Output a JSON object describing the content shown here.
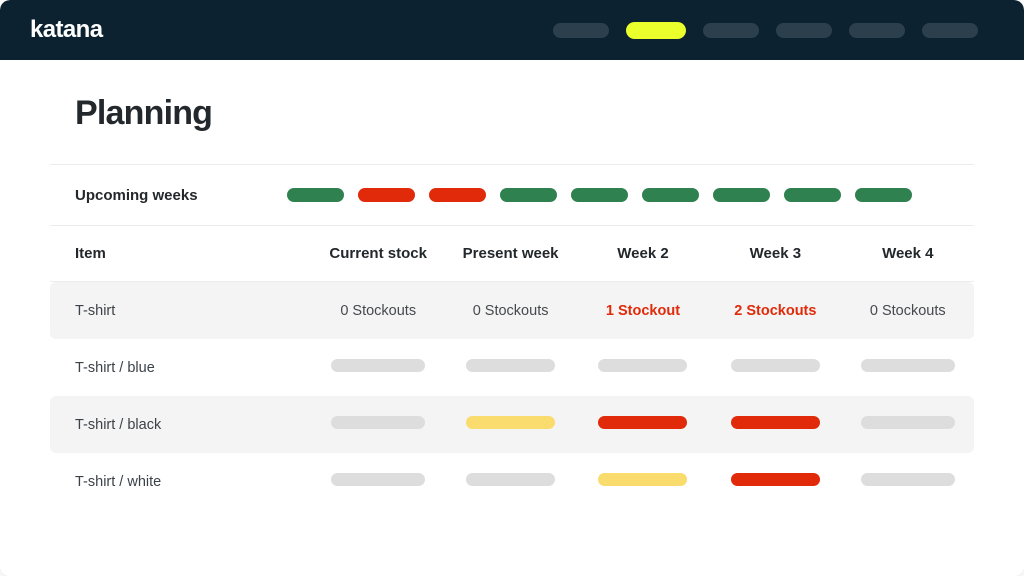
{
  "app": {
    "brand": "katana",
    "nav": [
      {
        "name": "nav-pill-1",
        "active": false
      },
      {
        "name": "nav-pill-2",
        "active": true
      },
      {
        "name": "nav-pill-3",
        "active": false
      },
      {
        "name": "nav-pill-4",
        "active": false
      },
      {
        "name": "nav-pill-5",
        "active": false
      },
      {
        "name": "nav-pill-6",
        "active": false
      }
    ]
  },
  "page": {
    "title": "Planning"
  },
  "upcoming": {
    "label": "Upcoming weeks",
    "pills": [
      "green",
      "red",
      "red",
      "green",
      "green",
      "green",
      "green",
      "green",
      "green"
    ]
  },
  "table": {
    "headers": {
      "item": "Item",
      "current_stock": "Current stock",
      "present_week": "Present week",
      "week2": "Week 2",
      "week3": "Week 3",
      "week4": "Week 4"
    },
    "rows": [
      {
        "item": "T-shirt",
        "type": "text",
        "striped": true,
        "cells": [
          {
            "text": "0 Stockouts",
            "alert": false
          },
          {
            "text": "0 Stockouts",
            "alert": false
          },
          {
            "text": "1 Stockout",
            "alert": true
          },
          {
            "text": "2 Stockouts",
            "alert": true
          },
          {
            "text": "0 Stockouts",
            "alert": false
          }
        ]
      },
      {
        "item": "T-shirt / blue",
        "type": "bars",
        "striped": false,
        "cells": [
          {
            "color": "gray"
          },
          {
            "color": "gray"
          },
          {
            "color": "gray"
          },
          {
            "color": "gray"
          },
          {
            "color": "gray"
          }
        ]
      },
      {
        "item": "T-shirt / black",
        "type": "bars",
        "striped": true,
        "cells": [
          {
            "color": "gray"
          },
          {
            "color": "yellow"
          },
          {
            "color": "red"
          },
          {
            "color": "red"
          },
          {
            "color": "gray"
          }
        ]
      },
      {
        "item": "T-shirt / white",
        "type": "bars",
        "striped": false,
        "cells": [
          {
            "color": "gray"
          },
          {
            "color": "gray"
          },
          {
            "color": "yellow"
          },
          {
            "color": "red"
          },
          {
            "color": "gray"
          }
        ]
      }
    ]
  },
  "colors": {
    "header_bg": "#0d2231",
    "nav_active": "#eaff2b",
    "nav_inactive": "#2b3f4d",
    "green": "#2f8150",
    "red": "#e02a09",
    "yellow": "#fadb6d",
    "gray": "#dddddd",
    "stripe": "#f4f4f4"
  }
}
